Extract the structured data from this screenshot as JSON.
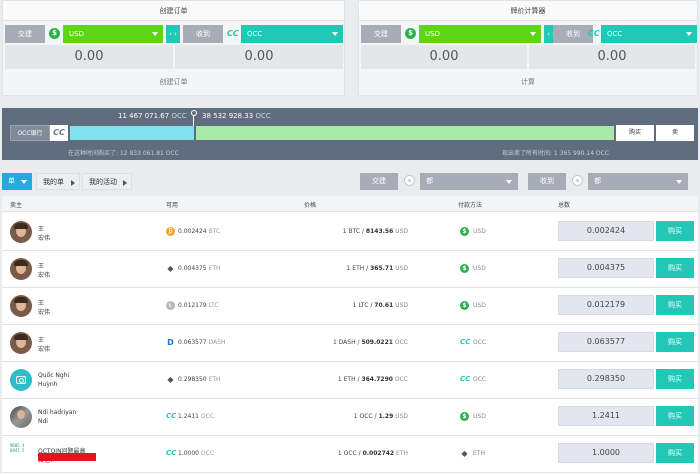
{
  "create_panel": {
    "title": "创建订单",
    "trade_label": "交建",
    "from_currency": "USD",
    "swap": "‹ ›",
    "to_label": "收到",
    "to_currency": "OCC",
    "amount_left": "0.00",
    "amount_right": "0.00",
    "footer": "创建订单"
  },
  "calc_panel": {
    "title": "牌价计算器",
    "trade_label": "交建",
    "from_currency": "USD",
    "swap": "‹ ›",
    "to_label": "收到",
    "to_currency": "OCC",
    "amount_left": "0.00",
    "amount_right": "0.00",
    "footer": "计算"
  },
  "depth": {
    "left_value": "11 467 071.67",
    "left_unit": "OCC",
    "right_value": "38 532 928.33",
    "right_unit": "OCC",
    "occ_button": "OCC银行",
    "buy_btn": "购买",
    "sell_btn": "卖",
    "bottom_left": "在这种时间购买了: 12 833 061.81 OCC",
    "bottom_right": "现出卖了所有时间: 1 365 990.14 OCC",
    "buy_fraction": 0.228
  },
  "filters": {
    "main_btn": "单",
    "my_orders": "我的单",
    "my_activity": "我的活动",
    "trade_label": "交建",
    "trade_select": "都",
    "receive_label": "收到",
    "receive_select": "都"
  },
  "table": {
    "headers": [
      "卖主",
      "可用",
      "价格",
      "付款方法",
      "总数"
    ],
    "buy_label": "购买",
    "rows": [
      {
        "avatar": "face",
        "name1": "王",
        "name2": "宏伟",
        "avail": "0.002424",
        "avail_unit": "BTC",
        "avail_icon": "btc",
        "price_base": "1 BTC",
        "price_val": "8143.56",
        "price_unit": "USD",
        "pay_icon": "usd",
        "pay": "USD",
        "total": "0.002424"
      },
      {
        "avatar": "face",
        "name1": "王",
        "name2": "宏伟",
        "avail": "0.004375",
        "avail_unit": "ETH",
        "avail_icon": "eth",
        "price_base": "1 ETH",
        "price_val": "365.71",
        "price_unit": "USD",
        "pay_icon": "usd",
        "pay": "USD",
        "total": "0.004375"
      },
      {
        "avatar": "face",
        "name1": "王",
        "name2": "宏伟",
        "avail": "0.012179",
        "avail_unit": "LTC",
        "avail_icon": "ltc",
        "price_base": "1 LTC",
        "price_val": "70.61",
        "price_unit": "USD",
        "pay_icon": "usd",
        "pay": "USD",
        "total": "0.012179"
      },
      {
        "avatar": "face",
        "name1": "王",
        "name2": "宏伟",
        "avail": "0.063577",
        "avail_unit": "DASH",
        "avail_icon": "dash",
        "price_base": "1 DASH",
        "price_val": "509.0221",
        "price_unit": "OCC",
        "pay_icon": "occ",
        "pay": "OCC",
        "total": "0.063577"
      },
      {
        "avatar": "cam",
        "name1": "Quốc Nghi",
        "name2": "Huỳnh",
        "avail": "0.298350",
        "avail_unit": "ETH",
        "avail_icon": "eth",
        "price_base": "1 ETH",
        "price_val": "364.7290",
        "price_unit": "OCC",
        "pay_icon": "occ",
        "pay": "OCC",
        "total": "0.298350"
      },
      {
        "avatar": "photo",
        "name1": "Ndi hadriyan",
        "name2": "Ndi",
        "avail": "1.2411",
        "avail_unit": "OCC",
        "avail_icon": "occ",
        "price_base": "1 OCC",
        "price_val": "1.29",
        "price_unit": "USD",
        "pay_icon": "usd",
        "pay": "USD",
        "total": "1.2411"
      },
      {
        "avatar": "qr",
        "name1": "OCTOIN问题最高",
        "name2": "微信：",
        "avail": "1.0000",
        "avail_unit": "OCC",
        "avail_icon": "occ",
        "price_base": "1 OCC",
        "price_val": "0.002742",
        "price_unit": "ETH",
        "pay_icon": "eth",
        "pay": "ETH",
        "total": "1.0000"
      }
    ]
  },
  "icons": {
    "dollar": "$",
    "occ": "CC",
    "eth": "◆",
    "btc": "₿",
    "ltc": "Ł",
    "dash": "D",
    "qr_lines": [
      "9605 4",
      "8847 5"
    ]
  }
}
